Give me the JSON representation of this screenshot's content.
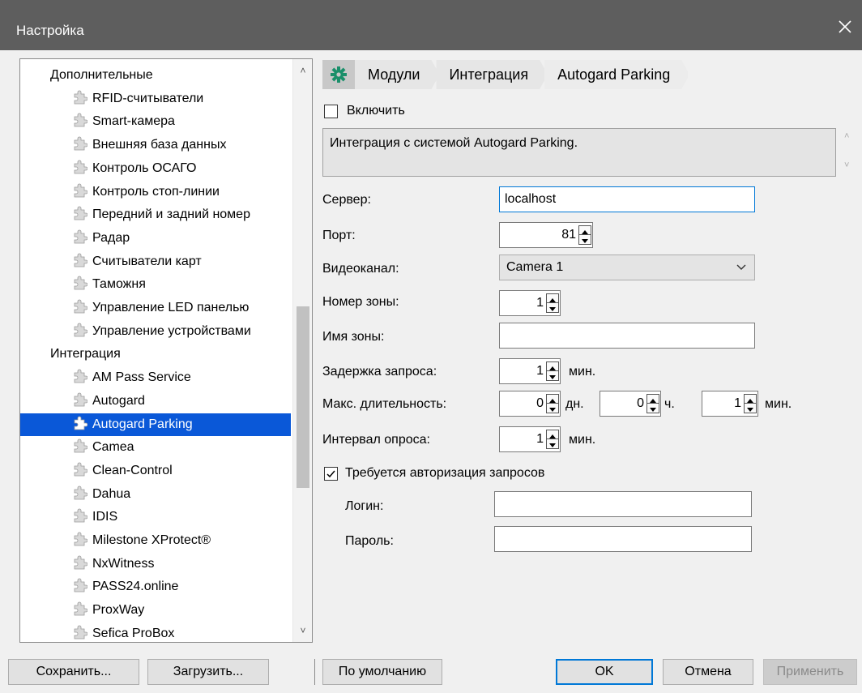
{
  "window": {
    "title": "Настройка"
  },
  "tree": {
    "items": [
      {
        "label": "Дополнительные",
        "level": 0,
        "selected": false
      },
      {
        "label": "RFID-считыватели",
        "level": 1,
        "selected": false
      },
      {
        "label": "Smart-камера",
        "level": 1,
        "selected": false
      },
      {
        "label": "Внешняя база данных",
        "level": 1,
        "selected": false
      },
      {
        "label": "Контроль ОСАГО",
        "level": 1,
        "selected": false
      },
      {
        "label": "Контроль стоп-линии",
        "level": 1,
        "selected": false
      },
      {
        "label": "Передний и задний номер",
        "level": 1,
        "selected": false
      },
      {
        "label": "Радар",
        "level": 1,
        "selected": false
      },
      {
        "label": "Считыватели карт",
        "level": 1,
        "selected": false
      },
      {
        "label": "Таможня",
        "level": 1,
        "selected": false
      },
      {
        "label": "Управление LED панелью",
        "level": 1,
        "selected": false
      },
      {
        "label": "Управление устройствами",
        "level": 1,
        "selected": false
      },
      {
        "label": "Интеграция",
        "level": 0,
        "selected": false
      },
      {
        "label": "AM Pass Service",
        "level": 1,
        "selected": false
      },
      {
        "label": "Autogard",
        "level": 1,
        "selected": false
      },
      {
        "label": "Autogard Parking",
        "level": 1,
        "selected": true
      },
      {
        "label": "Camea",
        "level": 1,
        "selected": false
      },
      {
        "label": "Clean-Control",
        "level": 1,
        "selected": false
      },
      {
        "label": "Dahua",
        "level": 1,
        "selected": false
      },
      {
        "label": "IDIS",
        "level": 1,
        "selected": false
      },
      {
        "label": "Milestone XProtect®",
        "level": 1,
        "selected": false
      },
      {
        "label": "NxWitness",
        "level": 1,
        "selected": false
      },
      {
        "label": "PASS24.online",
        "level": 1,
        "selected": false
      },
      {
        "label": "ProxWay",
        "level": 1,
        "selected": false
      },
      {
        "label": "Sefica ProBox",
        "level": 1,
        "selected": false
      }
    ]
  },
  "breadcrumb": {
    "items": [
      "Модули",
      "Интеграция",
      "Autogard Parking"
    ]
  },
  "form": {
    "enable_label": "Включить",
    "enable_checked": false,
    "description": "Интеграция с системой Autogard Parking.",
    "server_label": "Сервер:",
    "server_value": "localhost",
    "port_label": "Порт:",
    "port_value": "81",
    "video_label": "Видеоканал:",
    "video_value": "Camera 1",
    "zone_number_label": "Номер зоны:",
    "zone_number_value": "1",
    "zone_name_label": "Имя зоны:",
    "zone_name_value": "",
    "delay_label": "Задержка запроса:",
    "delay_value": "1",
    "delay_unit": "мин.",
    "maxdur_label": "Макс. длительность:",
    "maxdur_days": "0",
    "maxdur_days_unit": "дн.",
    "maxdur_hours": "0",
    "maxdur_hours_unit": "ч.",
    "maxdur_mins": "1",
    "maxdur_mins_unit": "мин.",
    "interval_label": "Интервал опроса:",
    "interval_value": "1",
    "interval_unit": "мин.",
    "auth_label": "Требуется авторизация запросов",
    "auth_checked": true,
    "login_label": "Логин:",
    "login_value": "",
    "password_label": "Пароль:",
    "password_value": ""
  },
  "buttons": {
    "save": "Сохранить...",
    "load": "Загрузить...",
    "defaults": "По умолчанию",
    "ok": "OK",
    "cancel": "Отмена",
    "apply": "Применить"
  },
  "colors": {
    "selection": "#0a58d8",
    "focus": "#0078d7",
    "titlebar": "#5e5e5e",
    "gear": "#1a8f6a"
  }
}
